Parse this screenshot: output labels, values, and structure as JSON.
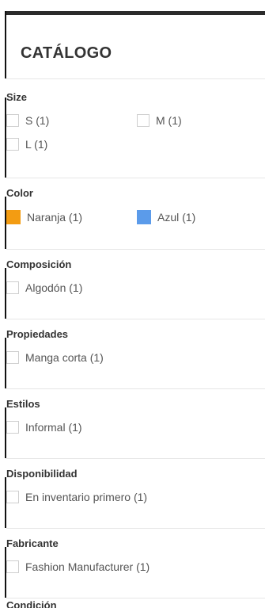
{
  "header": {
    "title": "CATÁLOGO"
  },
  "facets": {
    "size": {
      "title": "Size",
      "options": [
        {
          "label": "S (1)"
        },
        {
          "label": "M (1)"
        },
        {
          "label": "L (1)"
        }
      ]
    },
    "color": {
      "title": "Color",
      "options": [
        {
          "label": "Naranja (1)",
          "swatch": "#f39c12"
        },
        {
          "label": "Azul (1)",
          "swatch": "#5b9bea"
        }
      ]
    },
    "composicion": {
      "title": "Composición",
      "options": [
        {
          "label": "Algodón (1)"
        }
      ]
    },
    "propiedades": {
      "title": "Propiedades",
      "options": [
        {
          "label": "Manga corta (1)"
        }
      ]
    },
    "estilos": {
      "title": "Estilos",
      "options": [
        {
          "label": "Informal (1)"
        }
      ]
    },
    "disponibilidad": {
      "title": "Disponibilidad",
      "options": [
        {
          "label": "En inventario primero (1)"
        }
      ]
    },
    "fabricante": {
      "title": "Fabricante",
      "options": [
        {
          "label": "Fashion Manufacturer (1)"
        }
      ]
    },
    "condicion": {
      "title": "Condición"
    }
  }
}
